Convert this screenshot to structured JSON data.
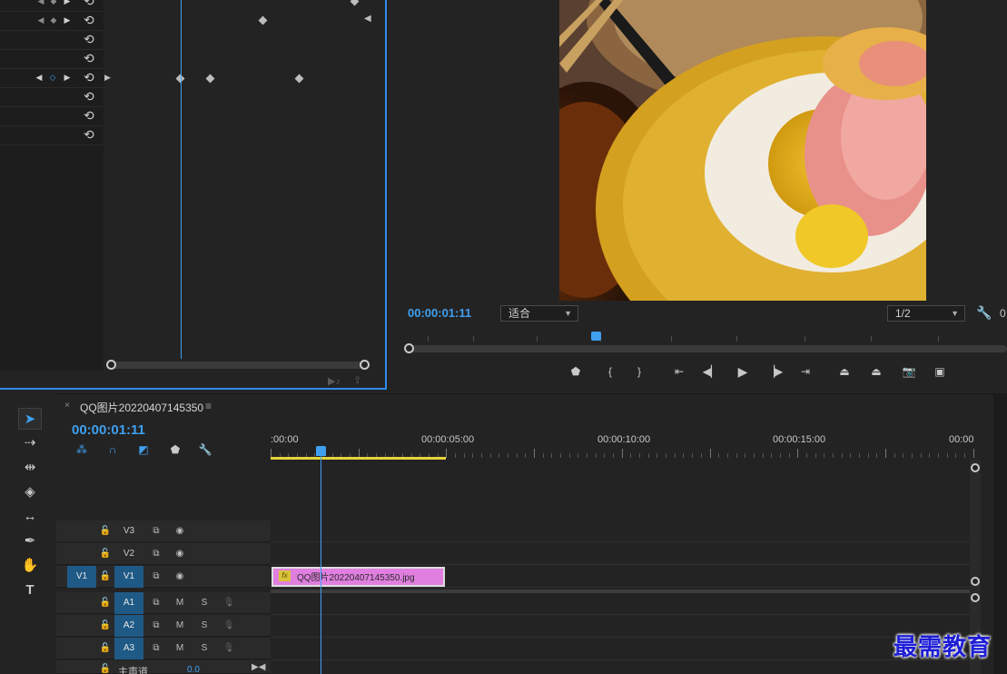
{
  "effect_controls": {
    "reset_icon": "reset-icon",
    "keyframe_icon": "keyframe-diamond-icon",
    "footer_icons": [
      "play-audio-icon",
      "export-icon"
    ]
  },
  "program_monitor": {
    "timecode": "00:00:01:11",
    "zoom_dropdown": "适合",
    "resolution_dropdown": "1/2",
    "resolution_extra": "0",
    "settings_icon": "wrench-icon",
    "controls": [
      "add-marker-icon",
      "mark-in-icon",
      "mark-out-icon",
      "go-to-in-icon",
      "step-back-icon",
      "play-icon",
      "step-forward-icon",
      "go-to-out-icon",
      "lift-icon",
      "extract-icon",
      "export-frame-icon",
      "compare-view-icon"
    ]
  },
  "tools": [
    "selection-tool-icon",
    "track-select-forward-icon",
    "ripple-edit-icon",
    "razor-icon",
    "slip-icon",
    "pen-icon",
    "hand-icon",
    "type-icon"
  ],
  "timeline": {
    "tab_close": "×",
    "sequence_name": "QQ图片20220407145350",
    "menu_icon": "≡",
    "timecode": "00:00:01:11",
    "ruler_labels": [
      ":00:00",
      "00:00:05:00",
      "00:00:10:00",
      "00:00:15:00",
      "00:00"
    ],
    "video_tracks": [
      {
        "source": "",
        "name": "V3"
      },
      {
        "source": "",
        "name": "V2"
      },
      {
        "source": "V1",
        "name": "V1"
      }
    ],
    "audio_tracks": [
      {
        "name": "A1",
        "m": "M",
        "s": "S"
      },
      {
        "name": "A2",
        "m": "M",
        "s": "S"
      },
      {
        "name": "A3",
        "m": "M",
        "s": "S"
      }
    ],
    "master_track": {
      "name": "主声道",
      "value": "0.0"
    },
    "clip": {
      "fx": "fx",
      "name": "QQ图片20220407145350.jpg"
    }
  },
  "watermark": "最需教育",
  "colors": {
    "accent": "#3fa0f0",
    "clip": "#e07fe0",
    "track_target": "#1f5a86",
    "work_area": "#e6d43a"
  }
}
